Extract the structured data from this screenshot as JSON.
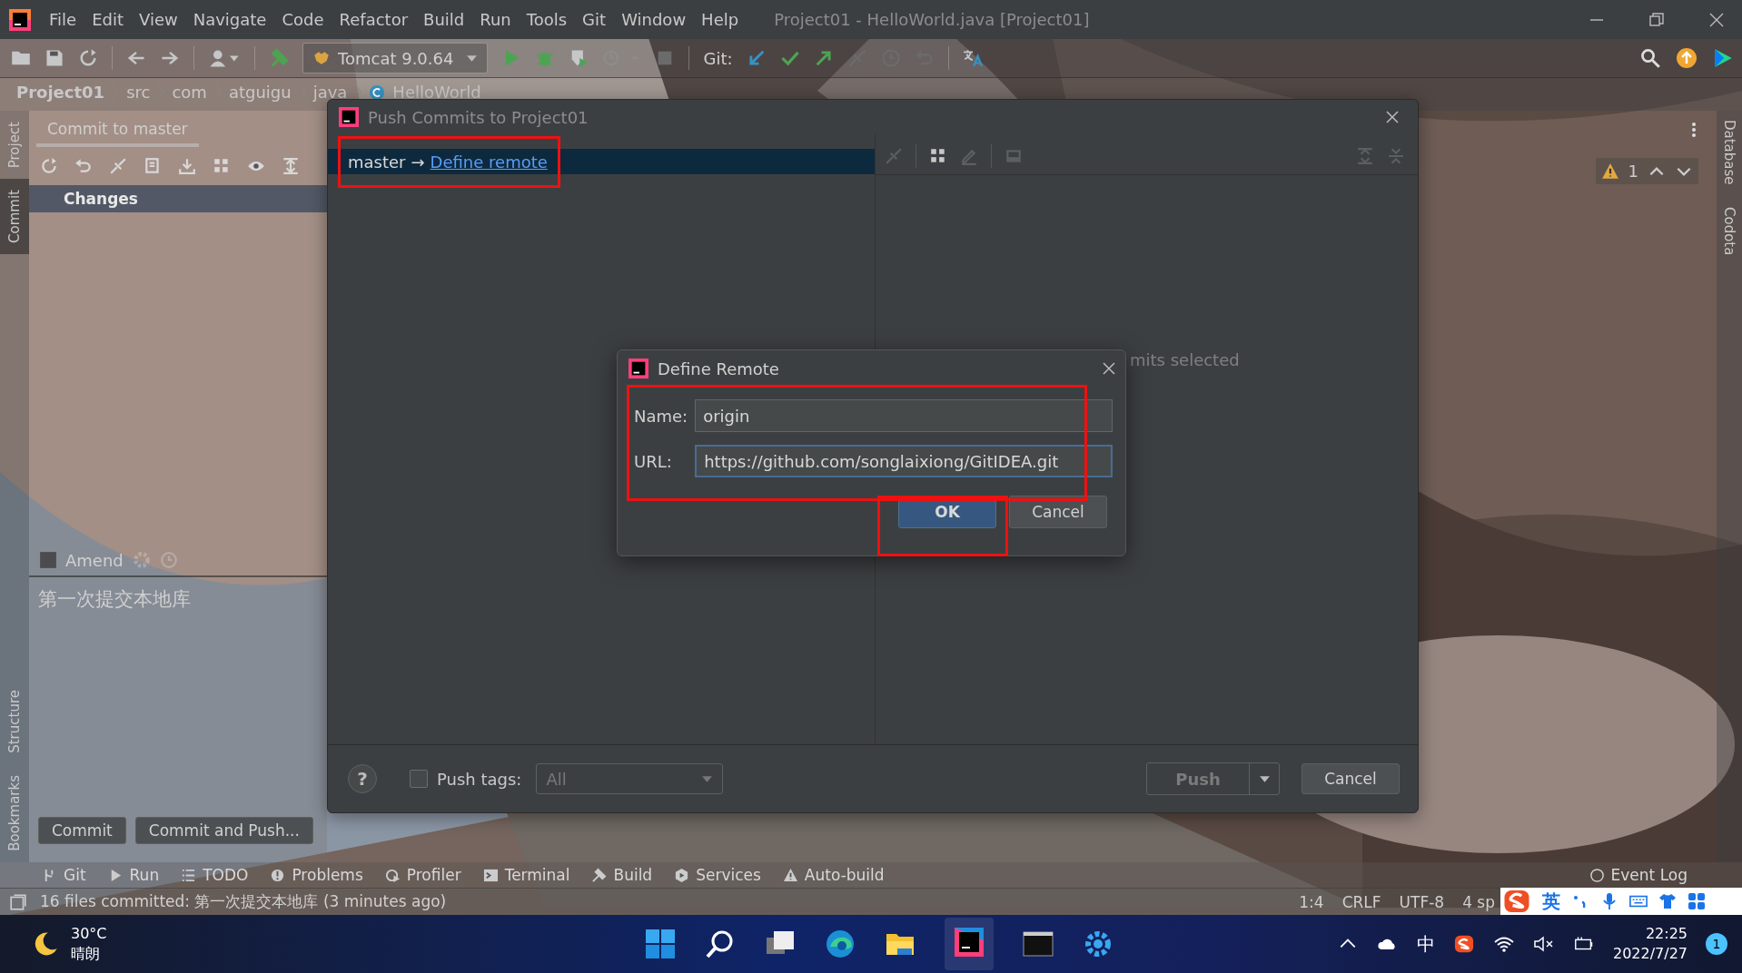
{
  "window": {
    "title": "Project01 - HelloWorld.java [Project01]"
  },
  "menu": [
    "File",
    "Edit",
    "View",
    "Navigate",
    "Code",
    "Refactor",
    "Build",
    "Run",
    "Tools",
    "Git",
    "Window",
    "Help"
  ],
  "toolbar": {
    "run_config": "Tomcat 9.0.64",
    "git_label": "Git:"
  },
  "breadcrumb": [
    "Project01",
    "src",
    "com",
    "atguigu",
    "java",
    "HelloWorld"
  ],
  "left_stripe": [
    {
      "label": "Project",
      "selected": false
    },
    {
      "label": "Commit",
      "selected": true
    }
  ],
  "left_stripe_bottom": [
    {
      "label": "Structure",
      "selected": false
    },
    {
      "label": "Bookmarks",
      "selected": false
    }
  ],
  "right_stripe": [
    "Database",
    "Codota"
  ],
  "inspection": {
    "count": "1"
  },
  "commit_panel": {
    "tab": "Commit to master",
    "changes": "Changes",
    "amend": {
      "label": "Amend",
      "checked": false
    },
    "message": "第一次提交本地库",
    "buttons": [
      "Commit",
      "Commit and Push..."
    ]
  },
  "push_dialog": {
    "title": "Push Commits to Project01",
    "branch": "master",
    "arrow": "→",
    "link": "Define remote",
    "empty_text": "mits selected",
    "push_tags": {
      "label": "Push tags:",
      "checked": false
    },
    "tags_select": "All",
    "help": "?",
    "push": "Push",
    "cancel": "Cancel"
  },
  "define_remote": {
    "title": "Define Remote",
    "fields": [
      {
        "label": "Name:",
        "value": "origin",
        "focused": false
      },
      {
        "label": "URL:",
        "value": "https://github.com/songlaixiong/GitIDEA.git",
        "focused": true
      }
    ],
    "ok": "OK",
    "cancel": "Cancel"
  },
  "tool_windows": [
    "Git",
    "Run",
    "TODO",
    "Problems",
    "Profiler",
    "Terminal",
    "Build",
    "Services",
    "Auto-build"
  ],
  "event_log": "Event Log",
  "status": {
    "message": "16 files committed: 第一次提交本地库 (3 minutes ago)",
    "items": [
      "1:4",
      "CRLF",
      "UTF-8",
      "4 sp"
    ]
  },
  "ime": {
    "mode": "英"
  },
  "taskbar": {
    "temp": "30°C",
    "weather": "晴朗",
    "tray_ime": "中",
    "time": "22:25",
    "date": "2022/7/27",
    "badge": "1"
  }
}
